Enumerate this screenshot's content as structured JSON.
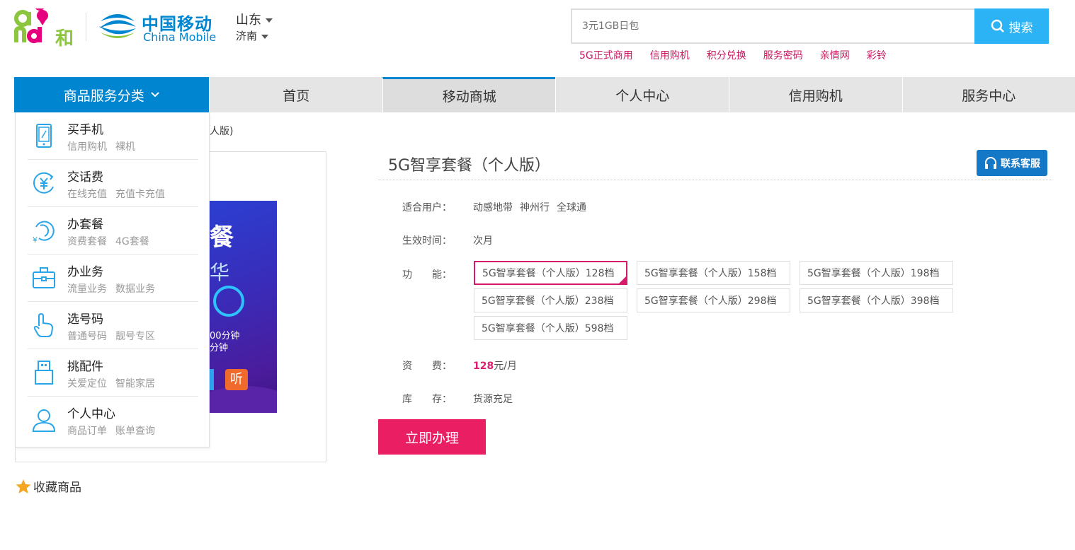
{
  "header": {
    "logo_and_text": "和",
    "logo_cm_cn": "中国移动",
    "logo_cm_en": "China Mobile",
    "region_province": "山东",
    "region_city": "济南",
    "search_placeholder": "3元1GB日包",
    "search_button": "搜索",
    "hot_links": [
      "5G正式商用",
      "信用购机",
      "积分兑换",
      "服务密码",
      "亲情网",
      "彩铃"
    ]
  },
  "nav": {
    "category_label": "商品服务分类",
    "items": [
      "首页",
      "移动商城",
      "个人中心",
      "信用购机",
      "服务中心"
    ],
    "active_index": 1
  },
  "breadcrumb_fragment": "人版)",
  "category_menu": [
    {
      "title": "买手机",
      "subs": [
        "信用购机",
        "裸机"
      ],
      "icon": "phone-icon"
    },
    {
      "title": "交话费",
      "subs": [
        "在线充值",
        "充值卡充值"
      ],
      "icon": "yuan-icon"
    },
    {
      "title": "办套餐",
      "subs": [
        "资费套餐",
        "4G套餐"
      ],
      "icon": "package-icon"
    },
    {
      "title": "办业务",
      "subs": [
        "流量业务",
        "数据业务"
      ],
      "icon": "briefcase-icon"
    },
    {
      "title": "选号码",
      "subs": [
        "普通号码",
        "靓号专区"
      ],
      "icon": "hand-tap-icon"
    },
    {
      "title": "挑配件",
      "subs": [
        "关爱定位",
        "智能家居"
      ],
      "icon": "accessory-icon"
    },
    {
      "title": "个人中心",
      "subs": [
        "商品订单",
        "账单查询"
      ],
      "icon": "user-icon"
    }
  ],
  "poster": {
    "text1": "餐",
    "text2": "华",
    "text3": "00分钟",
    "text4": "分钟",
    "ting": "听"
  },
  "favorite": "收藏商品",
  "product": {
    "title": "5G智享套餐（个人版）",
    "customer_service": "联系客服",
    "users_label": "适合用户：",
    "users": [
      "动感地带",
      "神州行",
      "全球通"
    ],
    "effective_label": "生效时间：",
    "effective_value": "次月",
    "function_label": "功　　能：",
    "options": [
      "5G智享套餐（个人版）128档",
      "5G智享套餐（个人版）158档",
      "5G智享套餐（个人版）198档",
      "5G智享套餐（个人版）238档",
      "5G智享套餐（个人版）298档",
      "5G智享套餐（个人版）398档",
      "5G智享套餐（个人版）598档"
    ],
    "selected_option": 0,
    "fee_label": "资　　费：",
    "fee_amount": "128",
    "fee_unit": "元/月",
    "stock_label": "库　　存：",
    "stock_value": "货源充足",
    "buy_button": "立即办理"
  },
  "colors": {
    "brand_blue": "#0085d0",
    "accent_pink": "#e91e63",
    "search_blue": "#2bb3f5",
    "link_pink": "#c8185f"
  }
}
